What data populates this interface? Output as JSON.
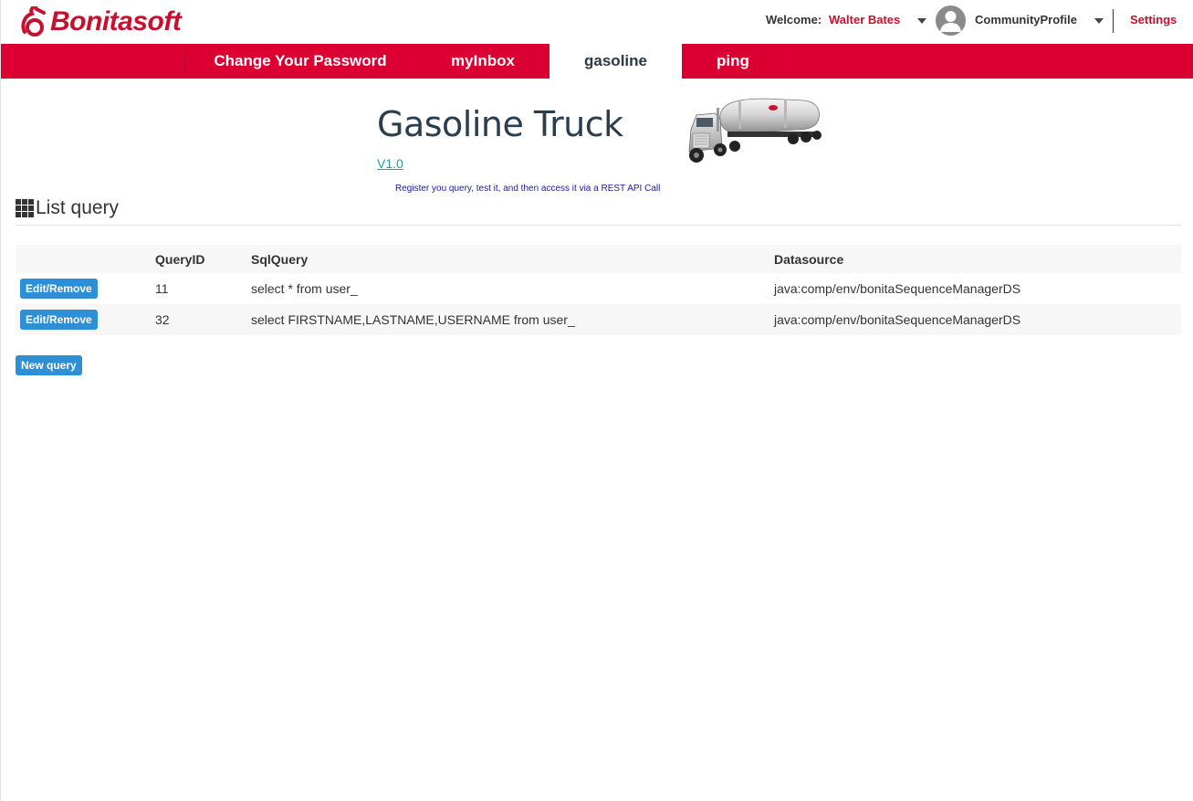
{
  "header": {
    "logo_text": "Bonitasoft",
    "welcome_label": "Welcome:",
    "user_name": "Walter Bates",
    "profile_name": "CommunityProfile",
    "settings_label": "Settings"
  },
  "nav": {
    "items": [
      {
        "label": "Change Your Password",
        "active": false
      },
      {
        "label": "myInbox",
        "active": false
      },
      {
        "label": "gasoline",
        "active": true
      },
      {
        "label": "ping",
        "active": false
      }
    ]
  },
  "hero": {
    "title": "Gasoline Truck",
    "version": "V1.0",
    "tagline": "Register you query, test it, and then access it via a REST API Call"
  },
  "section": {
    "title": "List query"
  },
  "table": {
    "headers": [
      "",
      "QueryID",
      "SqlQuery",
      "Datasource"
    ],
    "rows": [
      {
        "action": "Edit/Remove",
        "id": "11",
        "sql": "select * from user_",
        "datasource": "java:comp/env/bonitaSequenceManagerDS"
      },
      {
        "action": "Edit/Remove",
        "id": "32",
        "sql": "select FIRSTNAME,LASTNAME,USERNAME from user_",
        "datasource": "java:comp/env/bonitaSequenceManagerDS"
      }
    ]
  },
  "actions": {
    "new_query_label": "New query"
  },
  "colors": {
    "brand_red": "#dc0032",
    "button_blue": "#2d8fd5",
    "title_dark": "#2b3e4d"
  },
  "icons": {
    "logo": "bonitasoft-logo-icon",
    "avatar": "user-avatar-icon",
    "list": "grid-icon",
    "truck": "gasoline-truck-image"
  }
}
